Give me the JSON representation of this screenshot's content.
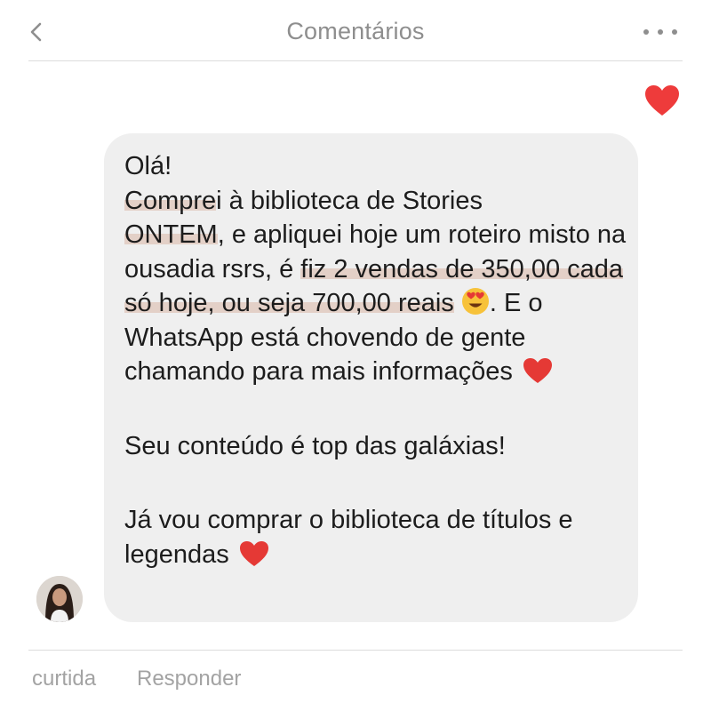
{
  "header": {
    "title": "Comentários",
    "back_icon": "chevron-left-icon",
    "more_icon": "more-horizontal-icon"
  },
  "like": {
    "icon": "heart-icon",
    "color": "#ee3b3b"
  },
  "message": {
    "greeting": "Olá!",
    "p1": {
      "s1": "Compre",
      "s2": "i à biblioteca de Stories",
      "s3": "ONTEM",
      "s4": ", e apliquei hoje um roteiro misto na ousadia rsrs, é ",
      "s5": "fiz 2 vendas de 350,00 cada só hoje, ou seja 700,00 reais",
      "s6": ". E  o WhatsApp está chovendo de gente chamando para mais informações"
    },
    "p2": "Seu conteúdo é top das galáxias!",
    "p3": "Já vou comprar o biblioteca de títulos e legendas",
    "highlight_color": "#d5aa96",
    "bubble_color": "#efefef"
  },
  "footer": {
    "liked": "curtida",
    "reply": "Responder"
  }
}
